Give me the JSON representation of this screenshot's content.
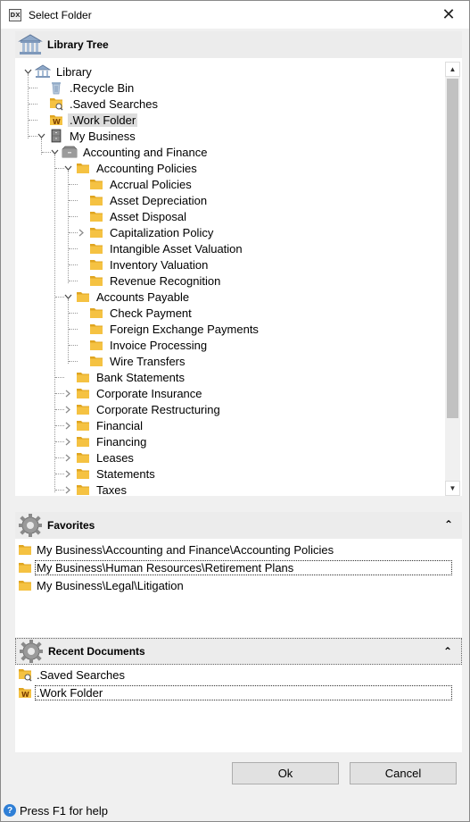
{
  "window": {
    "title": "Select Folder",
    "app_icon_text": "DX"
  },
  "library_panel": {
    "header": "Library Tree",
    "tree": [
      {
        "label": "Library",
        "depth": 0,
        "expanded": true,
        "icon": "library-icon"
      },
      {
        "label": ".Recycle Bin",
        "depth": 1,
        "icon": "recycle-bin-icon"
      },
      {
        "label": ".Saved Searches",
        "depth": 1,
        "icon": "saved-searches-icon"
      },
      {
        "label": ".Work Folder",
        "depth": 1,
        "icon": "work-folder-icon",
        "selected": true
      },
      {
        "label": "My Business",
        "depth": 1,
        "expanded": true,
        "icon": "cabinet-icon"
      },
      {
        "label": "Accounting and Finance",
        "depth": 2,
        "expanded": true,
        "icon": "drawer-icon"
      },
      {
        "label": "Accounting Policies",
        "depth": 3,
        "expanded": true,
        "icon": "folder-icon"
      },
      {
        "label": "Accrual Policies",
        "depth": 4,
        "icon": "folder-icon"
      },
      {
        "label": "Asset Depreciation",
        "depth": 4,
        "icon": "folder-icon"
      },
      {
        "label": "Asset Disposal",
        "depth": 4,
        "icon": "folder-icon"
      },
      {
        "label": "Capitalization Policy",
        "depth": 4,
        "collapsed": true,
        "icon": "folder-icon"
      },
      {
        "label": "Intangible Asset Valuation",
        "depth": 4,
        "icon": "folder-icon"
      },
      {
        "label": "Inventory Valuation",
        "depth": 4,
        "icon": "folder-icon"
      },
      {
        "label": "Revenue Recognition",
        "depth": 4,
        "icon": "folder-icon"
      },
      {
        "label": "Accounts Payable",
        "depth": 3,
        "expanded": true,
        "icon": "folder-icon"
      },
      {
        "label": "Check Payment",
        "depth": 4,
        "icon": "folder-icon"
      },
      {
        "label": "Foreign Exchange Payments",
        "depth": 4,
        "icon": "folder-icon"
      },
      {
        "label": "Invoice Processing",
        "depth": 4,
        "icon": "folder-icon"
      },
      {
        "label": "Wire Transfers",
        "depth": 4,
        "icon": "folder-icon"
      },
      {
        "label": "Bank Statements",
        "depth": 3,
        "icon": "folder-icon"
      },
      {
        "label": "Corporate Insurance",
        "depth": 3,
        "collapsed": true,
        "icon": "folder-icon"
      },
      {
        "label": "Corporate Restructuring",
        "depth": 3,
        "collapsed": true,
        "icon": "folder-icon"
      },
      {
        "label": "Financial",
        "depth": 3,
        "collapsed": true,
        "icon": "folder-icon"
      },
      {
        "label": "Financing",
        "depth": 3,
        "collapsed": true,
        "icon": "folder-icon"
      },
      {
        "label": "Leases",
        "depth": 3,
        "collapsed": true,
        "icon": "folder-icon"
      },
      {
        "label": "Statements",
        "depth": 3,
        "collapsed": true,
        "icon": "folder-icon"
      },
      {
        "label": "Taxes",
        "depth": 3,
        "collapsed": true,
        "icon": "folder-icon"
      }
    ]
  },
  "favorites_panel": {
    "header": "Favorites",
    "items": [
      {
        "label": "My Business\\Accounting and Finance\\Accounting Policies",
        "icon": "folder-icon"
      },
      {
        "label": "My Business\\Human Resources\\Retirement Plans",
        "icon": "folder-icon",
        "focused": true
      },
      {
        "label": "My Business\\Legal\\Litigation",
        "icon": "folder-icon"
      }
    ]
  },
  "recent_panel": {
    "header": "Recent Documents",
    "items": [
      {
        "label": ".Saved Searches",
        "icon": "saved-searches-icon"
      },
      {
        "label": ".Work Folder",
        "icon": "work-folder-icon",
        "focused": true
      }
    ]
  },
  "buttons": {
    "ok": "Ok",
    "cancel": "Cancel"
  },
  "statusbar": {
    "text": "Press F1 for help"
  },
  "colors": {
    "folder": "#f5c242",
    "folder_dark": "#e0a520",
    "selection": "#dcdcdc",
    "header_bg": "#ececec"
  }
}
